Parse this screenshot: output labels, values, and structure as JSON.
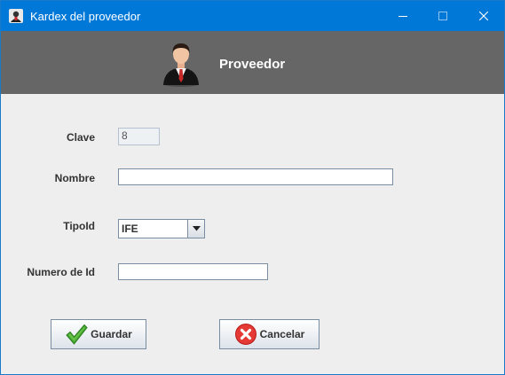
{
  "window": {
    "title": "Kardex del proveedor",
    "accent_color": "#0078d7",
    "controls": {
      "minimize_icon": "minimize-icon",
      "maximize_icon": "maximize-icon",
      "close_icon": "close-icon"
    }
  },
  "banner": {
    "title": "Proveedor",
    "avatar_icon": "businessman-avatar-icon",
    "background_color": "#666666"
  },
  "form": {
    "clave": {
      "label": "Clave",
      "value": "8"
    },
    "nombre": {
      "label": "Nombre",
      "value": ""
    },
    "tipoid": {
      "label": "TipoId",
      "selected": "IFE"
    },
    "numero_id": {
      "label": "Numero de Id",
      "value": ""
    }
  },
  "buttons": {
    "save": {
      "label": "Guardar",
      "icon": "checkmark-icon"
    },
    "cancel": {
      "label": "Cancelar",
      "icon": "cancel-x-icon"
    }
  }
}
